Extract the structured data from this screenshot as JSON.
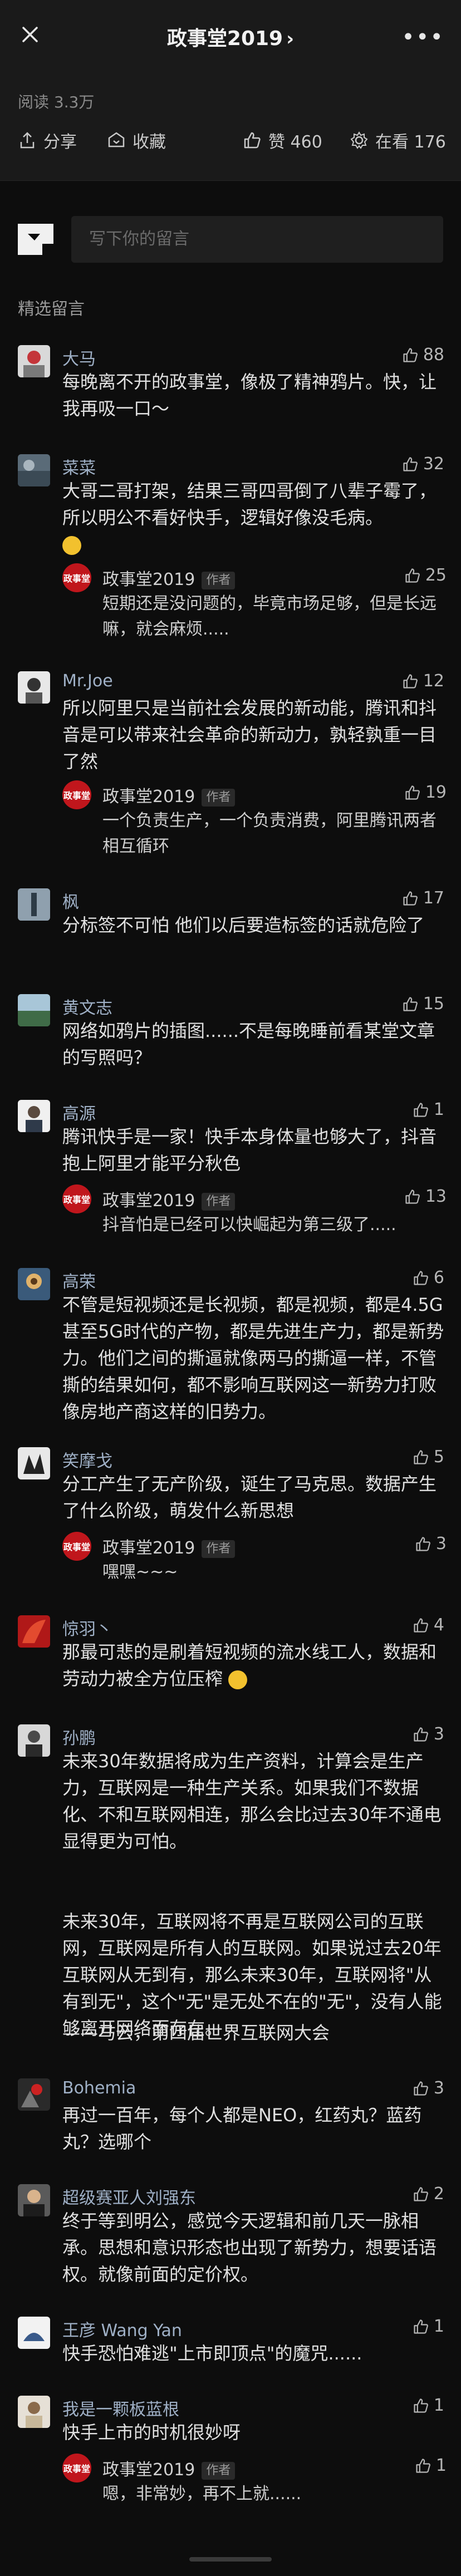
{
  "topbar": {
    "title": "政事堂2019",
    "chevron": "›"
  },
  "header": {
    "reads": "阅读 3.3万",
    "share": "分享",
    "favorite": "收藏",
    "like": "赞 460",
    "watching": "在看 176"
  },
  "compose": {
    "placeholder": "写下你的留言"
  },
  "section_label": "精选留言",
  "comments": [
    {
      "name": "大马",
      "likes": "88",
      "text": "每晚离不开的政事堂，像极了精神鸦片。快，让我再吸一口～"
    },
    {
      "name": "菜菜",
      "likes": "32",
      "text": "大哥二哥打架，结果三哥四哥倒了八辈子霉了，所以明公不看好快手，逻辑好像没毛病。",
      "reply": {
        "name": "政事堂2019",
        "badge": "作者",
        "likes": "25",
        "text": "短期还是没问题的，毕竟市场足够，但是长远嘛，就会麻烦....."
      }
    },
    {
      "name": "Mr.Joe",
      "likes": "12",
      "text": "所以阿里只是当前社会发展的新动能，腾讯和抖音是可以带来社会革命的新动力，孰轻孰重一目了然",
      "reply": {
        "name": "政事堂2019",
        "badge": "作者",
        "likes": "19",
        "text": "一个负责生产，一个负责消费，阿里腾讯两者相互循环"
      }
    },
    {
      "name": "枫",
      "likes": "17",
      "text": "分标签不可怕  他们以后要造标签的话就危险了"
    },
    {
      "name": "黄文志",
      "likes": "15",
      "text": "网络如鸦片的插图......不是每晚睡前看某堂文章的写照吗？"
    },
    {
      "name": "高源",
      "likes": "1",
      "text": "腾讯快手是一家！快手本身体量也够大了，抖音抱上阿里才能平分秋色",
      "reply": {
        "name": "政事堂2019",
        "badge": "作者",
        "likes": "13",
        "text": "抖音怕是已经可以快崛起为第三级了....."
      }
    },
    {
      "name": "高荣",
      "likes": "6",
      "text": "不管是短视频还是长视频，都是视频，都是4.5G甚至5G时代的产物，都是先进生产力，都是新势力。他们之间的撕逼就像两马的撕逼一样，不管撕的结果如何，都不影响互联网这一新势力打败像房地产商这样的旧势力。"
    },
    {
      "name": "笑摩戈",
      "likes": "5",
      "text": "分工产生了无产阶级，诞生了马克思。数据产生了什么阶级，萌发什么新思想",
      "reply": {
        "name": "政事堂2019",
        "badge": "作者",
        "likes": "3",
        "text": "嘿嘿~~~"
      }
    },
    {
      "name": "惊羽丶",
      "likes": "4",
      "text": "那最可悲的是刷着短视频的流水线工人，数据和劳动力被全方位压榨"
    },
    {
      "name": "孙鹏",
      "likes": "3",
      "text": "未来30年数据将成为生产资料，计算会是生产力，互联网是一种生产关系。如果我们不数据化、不和互联网相连，那么会比过去30年不通电显得更为可怕。",
      "text2": "未来30年，互联网将不再是互联网公司的互联网，互联网是所有人的互联网。如果说过去20年互联网从无到有，那么未来30年，互联网将\"从有到无\"，这个\"无\"是无处不在的\"无\"，没有人能够离开网络而存在。",
      "text3": "——马云，第四届世界互联网大会"
    },
    {
      "name": "Bohemia",
      "likes": "3",
      "text": "再过一百年，每个人都是NEO，红药丸？蓝药丸？选哪个"
    },
    {
      "name": "超级赛亚人刘强东",
      "likes": "2",
      "text": "终于等到明公，感觉今天逻辑和前几天一脉相承。思想和意识形态也出现了新势力，想要话语权。就像前面的定价权。"
    },
    {
      "name": "王彦 Wang Yan",
      "likes": "1",
      "text": "快手恐怕难逃\"上市即顶点\"的魔咒......"
    },
    {
      "name": "我是一颗板蓝根",
      "likes": "1",
      "text": "快手上市的时机很妙呀",
      "reply": {
        "name": "政事堂2019",
        "badge": "作者",
        "likes": "1",
        "text": "嗯，非常妙，再不上就......"
      }
    }
  ],
  "colors": {
    "background": "#0d0d0d",
    "panel": "#1a1a1a",
    "username": "#9fb0c6",
    "author_avatar": "#c0161c"
  },
  "icons": [
    "close-icon",
    "more-icon",
    "share-icon",
    "favorite-icon",
    "thumbs-up-icon",
    "watching-icon"
  ]
}
